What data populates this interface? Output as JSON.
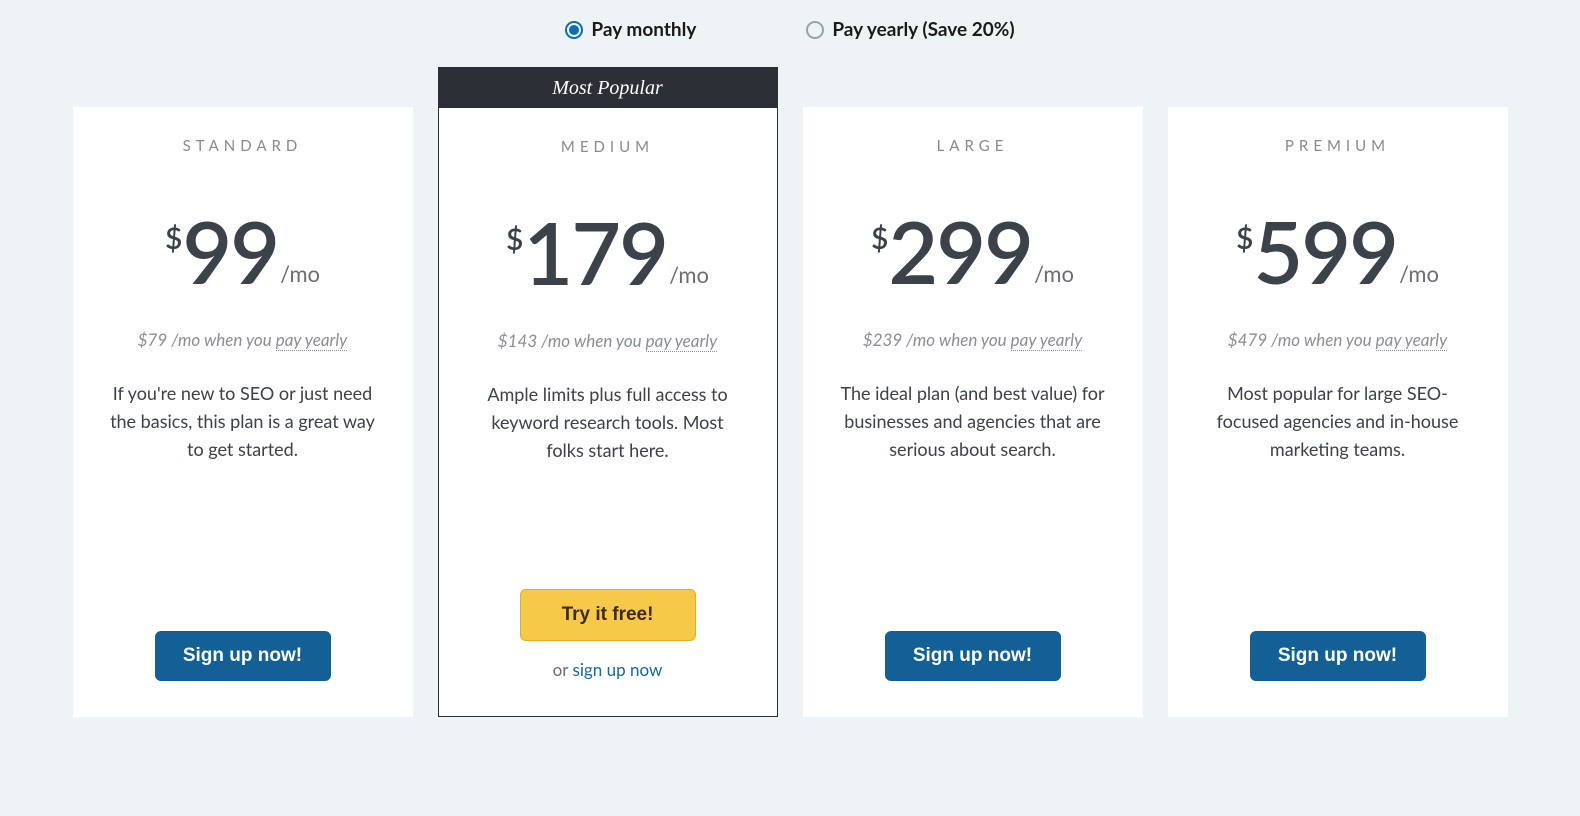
{
  "toggle": {
    "option_monthly": "Pay monthly",
    "option_yearly": "Pay yearly (Save 20%)",
    "selected": "monthly"
  },
  "popular_label": "Most Popular",
  "per_label": "/mo",
  "currency_symbol": "$",
  "yearly_note_prefix_per": " /mo when you ",
  "yearly_note_link": "pay yearly",
  "cta_signup": "Sign up now!",
  "cta_try": "Try it free!",
  "alt_prefix": "or ",
  "alt_link": "sign up now",
  "plans": [
    {
      "name": "STANDARD",
      "price": "99",
      "yearly_price": "$79",
      "desc": "If you're new to SEO or just need the basics, this plan is a great way to get started.",
      "popular": false,
      "cta_variant": "signup"
    },
    {
      "name": "MEDIUM",
      "price": "179",
      "yearly_price": "$143",
      "desc": "Ample limits plus full access to keyword research tools. Most folks start here.",
      "popular": true,
      "cta_variant": "try"
    },
    {
      "name": "LARGE",
      "price": "299",
      "yearly_price": "$239",
      "desc": "The ideal plan (and best value) for businesses and agencies that are serious about search.",
      "popular": false,
      "cta_variant": "signup"
    },
    {
      "name": "PREMIUM",
      "price": "599",
      "yearly_price": "$479",
      "desc": "Most popular for large SEO-focused agencies and in-house marketing teams.",
      "popular": false,
      "cta_variant": "signup"
    }
  ]
}
